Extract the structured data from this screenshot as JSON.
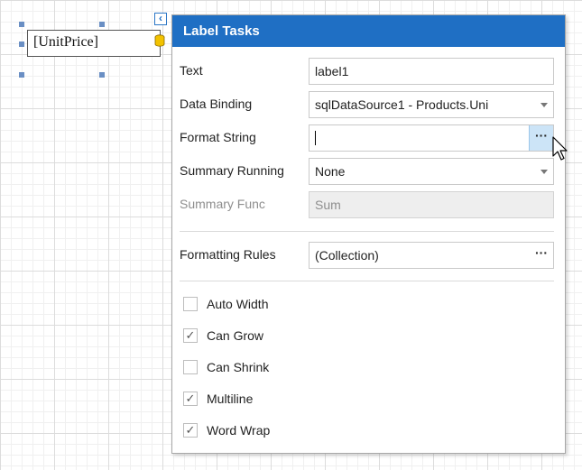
{
  "design_surface": {
    "label_text": "[UnitPrice]",
    "smart_tag_glyph": "‹"
  },
  "panel": {
    "title": "Label Tasks",
    "accent_color": "#1f6fc4",
    "text": {
      "label": "Text",
      "value": "label1"
    },
    "data_binding": {
      "label": "Data Binding",
      "value": "sqlDataSource1 - Products.Uni"
    },
    "format_string": {
      "label": "Format String",
      "value": "",
      "button": "···"
    },
    "summary_running": {
      "label": "Summary Running",
      "value": "None"
    },
    "summary_func": {
      "label": "Summary Func",
      "value": "Sum"
    },
    "formatting_rules": {
      "label": "Formatting Rules",
      "value": "(Collection)",
      "button": "···"
    },
    "options": [
      {
        "label": "Auto Width",
        "checked": false
      },
      {
        "label": "Can Grow",
        "checked": true
      },
      {
        "label": "Can Shrink",
        "checked": false
      },
      {
        "label": "Multiline",
        "checked": true
      },
      {
        "label": "Word Wrap",
        "checked": true
      }
    ]
  }
}
